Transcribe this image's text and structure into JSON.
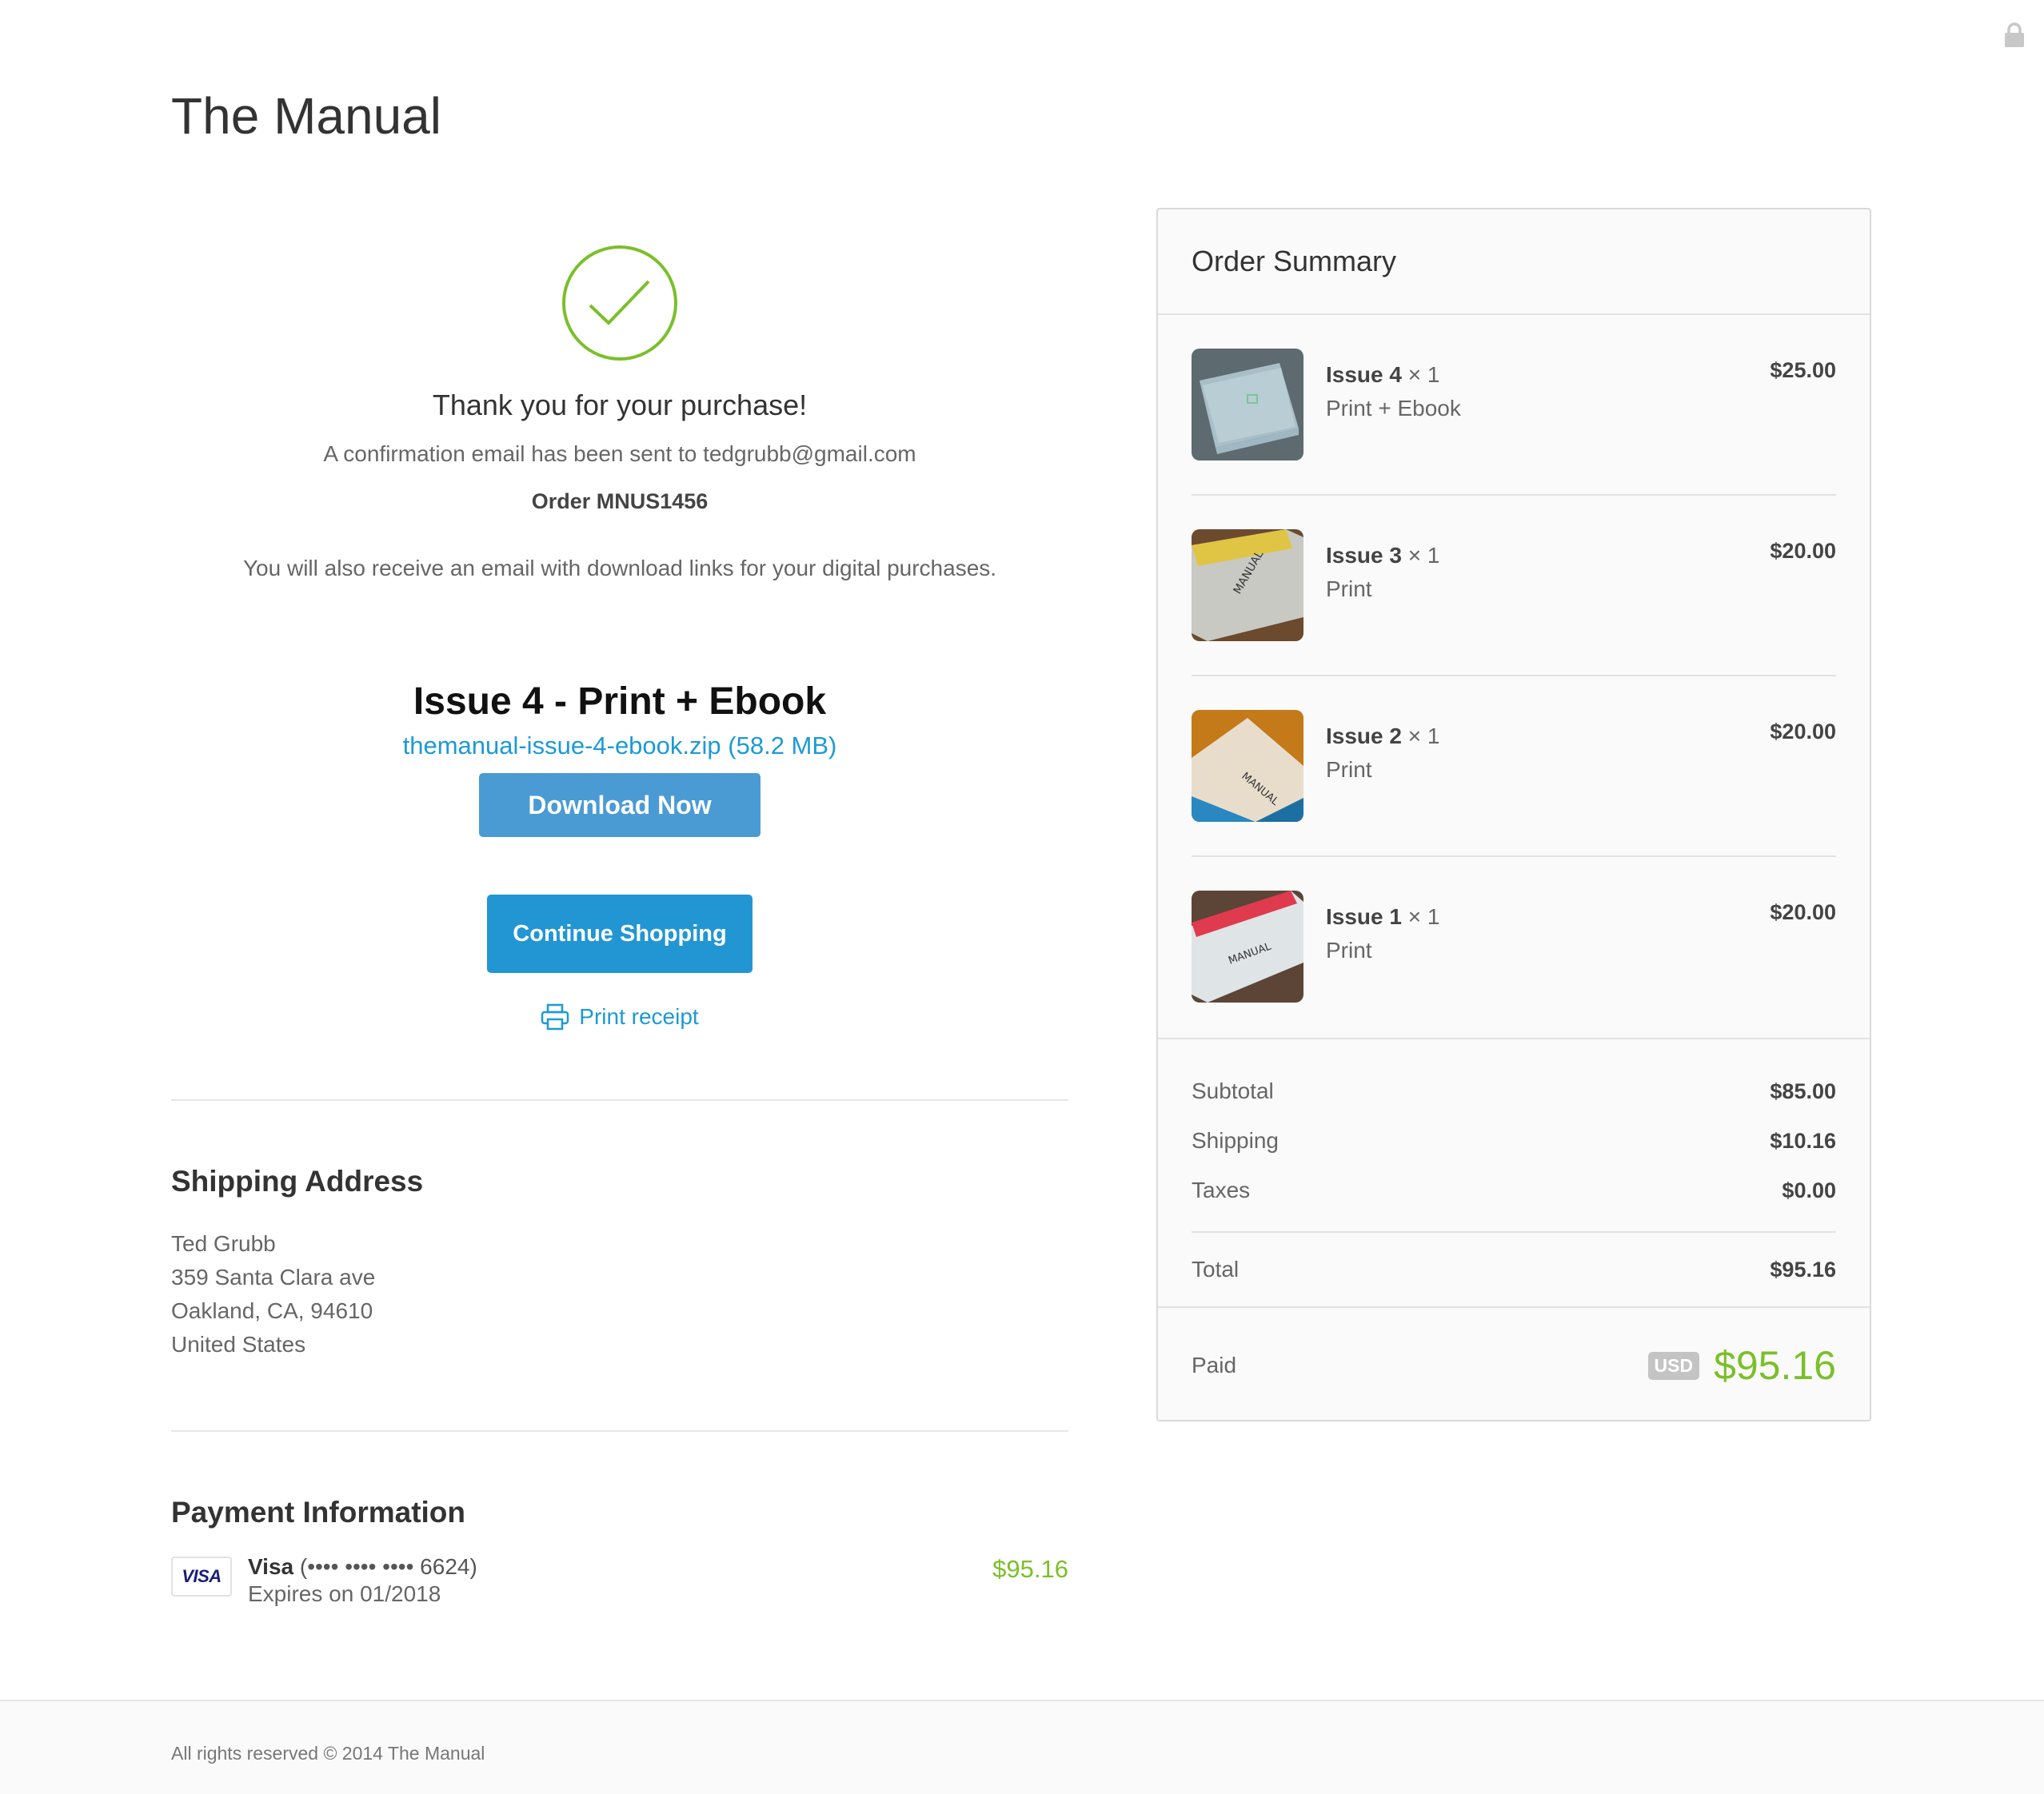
{
  "store": {
    "title": "The Manual"
  },
  "confirmation": {
    "thanks": "Thank you for your purchase!",
    "email_note": "A confirmation email has been sent to tedgrubb@gmail.com",
    "order": "Order MNUS1456",
    "digital_note": "You will also receive an email with download links for your digital purchases."
  },
  "download": {
    "title": "Issue 4 - Print + Ebook",
    "filename": "themanual-issue-4-ebook.zip",
    "filesize": "(58.2 MB)",
    "button": "Download Now"
  },
  "actions": {
    "continue": "Continue Shopping",
    "print": "Print receipt"
  },
  "shipping": {
    "heading": "Shipping Address",
    "lines": [
      "Ted Grubb",
      "359 Santa Clara ave",
      "Oakland, CA, 94610",
      "United States"
    ]
  },
  "payment": {
    "heading": "Payment Information",
    "card_brand": "VISA",
    "card_name": "Visa",
    "card_masked": "(•••• •••• •••• 6624)",
    "expires": "Expires on 01/2018",
    "amount": "$95.16"
  },
  "summary": {
    "heading": "Order Summary",
    "items": [
      {
        "name": "Issue 4",
        "qty": " × 1",
        "variant": "Print + Ebook",
        "price": "$25.00",
        "accent": "#9fb8c4"
      },
      {
        "name": "Issue 3",
        "qty": " × 1",
        "variant": "Print",
        "price": "$20.00",
        "accent": "#e0c545"
      },
      {
        "name": "Issue 2",
        "qty": " × 1",
        "variant": "Print",
        "price": "$20.00",
        "accent": "#2a88c0"
      },
      {
        "name": "Issue 1",
        "qty": " × 1",
        "variant": "Print",
        "price": "$20.00",
        "accent": "#e03a4e"
      }
    ],
    "subtotal_label": "Subtotal",
    "subtotal": "$85.00",
    "shipping_label": "Shipping",
    "shipping": "$10.16",
    "taxes_label": "Taxes",
    "taxes": "$0.00",
    "total_label": "Total",
    "total": "$95.16",
    "paid_label": "Paid",
    "currency": "USD",
    "paid": "$95.16"
  },
  "footer": {
    "text": "All rights reserved © 2014 The Manual"
  },
  "colors": {
    "accent_blue": "#1c9ad6",
    "button_blue": "#4a9ad4",
    "success_green": "#7bc02a"
  },
  "icons": [
    "lock-icon",
    "checkmark-circle-icon",
    "printer-icon",
    "visa-logo"
  ]
}
